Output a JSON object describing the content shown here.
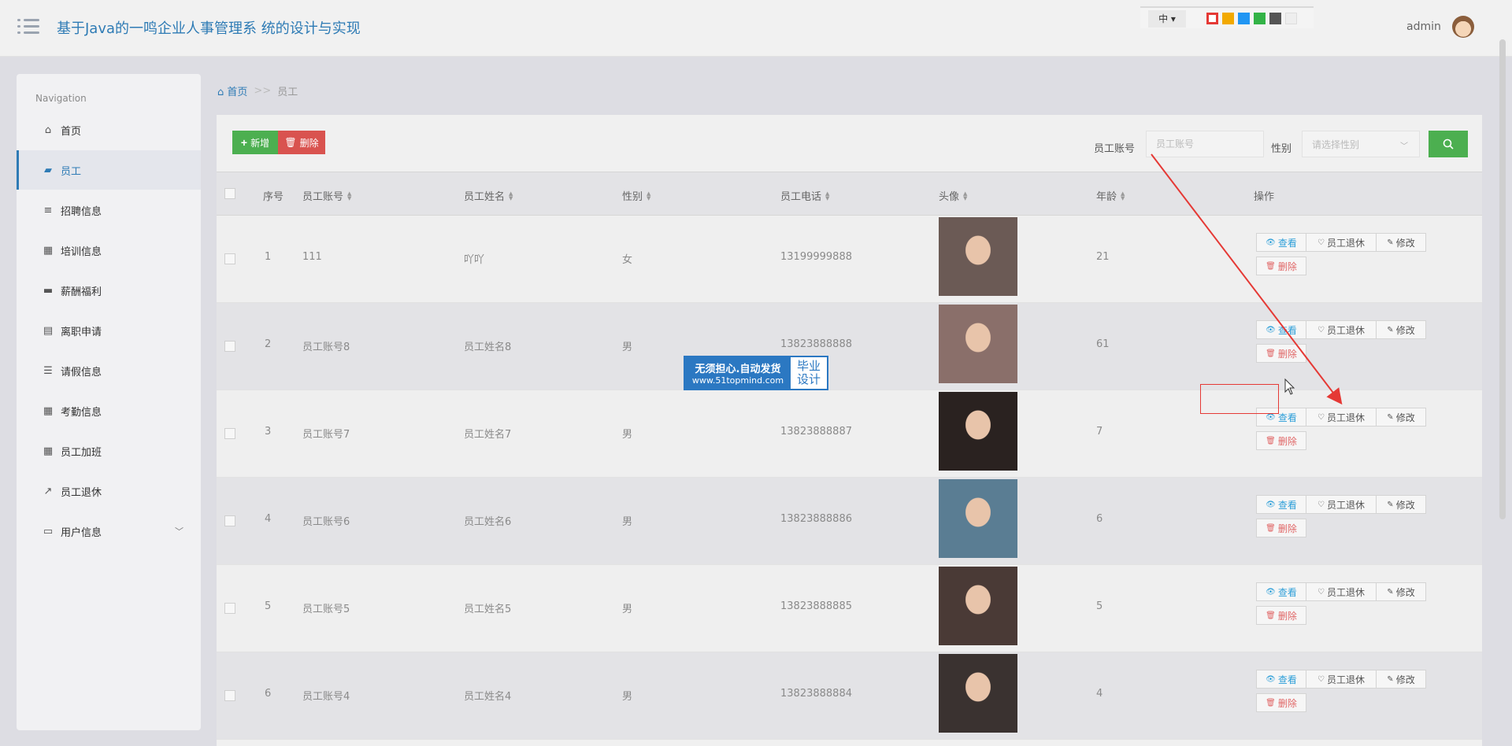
{
  "header": {
    "title": "基于Java的一鸣企业人事管理系 统的设计与实现",
    "lang_label": "中",
    "theme_colors": [
      "#e53935",
      "#f2a900",
      "#2196f3",
      "#33b347",
      "#555555",
      "#eeeeee"
    ],
    "user": "admin"
  },
  "nav": {
    "heading": "Navigation",
    "items": [
      {
        "label": "首页",
        "icon": "home-icon"
      },
      {
        "label": "员工",
        "icon": "briefcase-icon"
      },
      {
        "label": "招聘信息",
        "icon": "list-icon"
      },
      {
        "label": "培训信息",
        "icon": "grid-icon"
      },
      {
        "label": "薪酬福利",
        "icon": "monitor-icon"
      },
      {
        "label": "离职申请",
        "icon": "clipboard-icon"
      },
      {
        "label": "请假信息",
        "icon": "sliders-icon"
      },
      {
        "label": "考勤信息",
        "icon": "grid-icon"
      },
      {
        "label": "员工加班",
        "icon": "grid-icon"
      },
      {
        "label": "员工退休",
        "icon": "chart-icon"
      },
      {
        "label": "用户信息",
        "icon": "card-icon"
      }
    ],
    "active_index": 1
  },
  "breadcrumb": {
    "home": "首页",
    "sep": ">>",
    "current": "员工"
  },
  "toolbar": {
    "add_label": "新增",
    "delete_label": "删除",
    "account_label": "员工账号",
    "account_placeholder": "员工账号",
    "gender_label": "性别",
    "gender_placeholder": "请选择性别"
  },
  "table": {
    "columns": [
      "序号",
      "员工账号",
      "员工姓名",
      "性别",
      "员工电话",
      "头像",
      "年龄",
      "操作"
    ],
    "rows": [
      {
        "no": "1",
        "account": "111",
        "name": "吖吖",
        "gender": "女",
        "phone": "13199999888",
        "age": "21",
        "photo_tone": "#6b5a55"
      },
      {
        "no": "2",
        "account": "员工账号8",
        "name": "员工姓名8",
        "gender": "男",
        "phone": "13823888888",
        "age": "61",
        "photo_tone": "#8a6f6a"
      },
      {
        "no": "3",
        "account": "员工账号7",
        "name": "员工姓名7",
        "gender": "男",
        "phone": "13823888887",
        "age": "7",
        "photo_tone": "#2a2220"
      },
      {
        "no": "4",
        "account": "员工账号6",
        "name": "员工姓名6",
        "gender": "男",
        "phone": "13823888886",
        "age": "6",
        "photo_tone": "#5a7d93"
      },
      {
        "no": "5",
        "account": "员工账号5",
        "name": "员工姓名5",
        "gender": "男",
        "phone": "13823888885",
        "age": "5",
        "photo_tone": "#4a3a36"
      },
      {
        "no": "6",
        "account": "员工账号4",
        "name": "员工姓名4",
        "gender": "男",
        "phone": "13823888884",
        "age": "4",
        "photo_tone": "#3a3230"
      }
    ],
    "actions": {
      "view": "查看",
      "retire": "员工退休",
      "edit": "修改",
      "delete": "删除"
    }
  },
  "watermark": {
    "line1": "无须担心.自动发货",
    "line2": "www.51topmind.com",
    "badge1": "毕业",
    "badge2": "设计"
  }
}
